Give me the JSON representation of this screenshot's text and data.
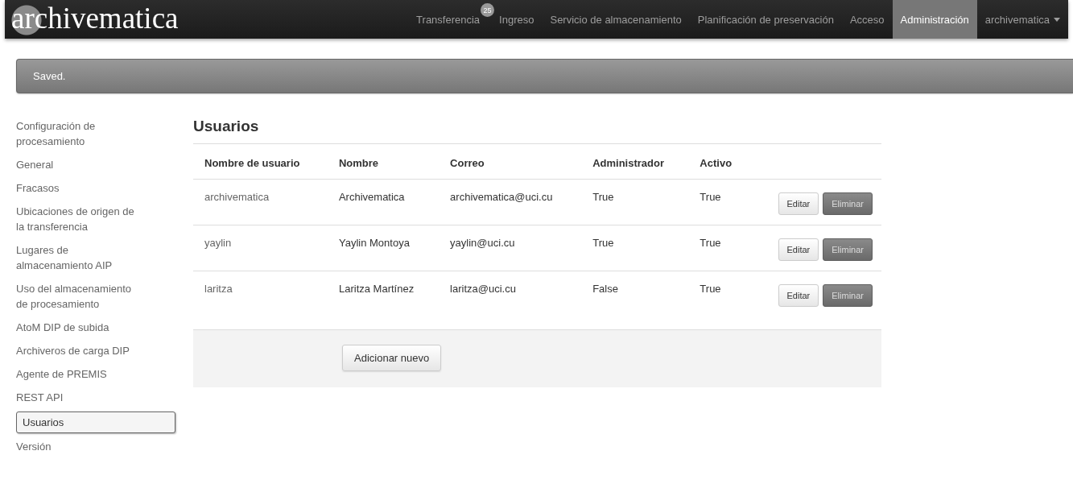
{
  "navbar": {
    "brand": "archivematica",
    "items": [
      {
        "label": "Transferencia",
        "badge": "25",
        "selected": false
      },
      {
        "label": "Ingreso",
        "selected": false
      },
      {
        "label": "Servicio de almacenamiento",
        "selected": false
      },
      {
        "label": "Planificación de preservación",
        "selected": false
      },
      {
        "label": "Acceso",
        "selected": false
      },
      {
        "label": "Administración",
        "selected": true
      },
      {
        "label": "archivematica",
        "kind": "dropdown",
        "selected": false
      }
    ]
  },
  "alert": {
    "message": "Saved."
  },
  "sidebar": {
    "items": [
      {
        "label": "Configuración de procesamiento",
        "selected": false
      },
      {
        "label": "General",
        "selected": false
      },
      {
        "label": "Fracasos",
        "selected": false
      },
      {
        "label": "Ubicaciones de origen de la transferencia",
        "selected": false
      },
      {
        "label": "Lugares de almacenamiento AIP",
        "selected": false
      },
      {
        "label": "Uso del almacenamiento de procesamiento",
        "selected": false
      },
      {
        "label": "AtoM DIP de subida",
        "selected": false
      },
      {
        "label": "Archiveros de carga DIP",
        "selected": false
      },
      {
        "label": "Agente de PREMIS",
        "selected": false
      },
      {
        "label": "REST API",
        "selected": false
      },
      {
        "label": "Usuarios",
        "selected": true
      },
      {
        "label": "Versión",
        "selected": false
      }
    ]
  },
  "content": {
    "title": "Usuarios",
    "table": {
      "columns": [
        "Nombre de usuario",
        "Nombre",
        "Correo",
        "Administrador",
        "Activo"
      ],
      "rows": [
        {
          "cells": [
            "archivematica",
            "Archivematica",
            "archivematica@uci.cu",
            "True",
            "True"
          ],
          "actions": [
            "Editar",
            "Eliminar"
          ]
        },
        {
          "cells": [
            "yaylin",
            "Yaylin Montoya",
            "yaylin@uci.cu",
            "True",
            "True"
          ],
          "actions": [
            "Editar",
            "Eliminar"
          ]
        },
        {
          "cells": [
            "laritza",
            "Laritza Martínez",
            "laritza@uci.cu",
            "False",
            "True"
          ],
          "actions": [
            "Editar",
            "Eliminar"
          ]
        }
      ]
    },
    "add_button": "Adicionar nuevo"
  }
}
